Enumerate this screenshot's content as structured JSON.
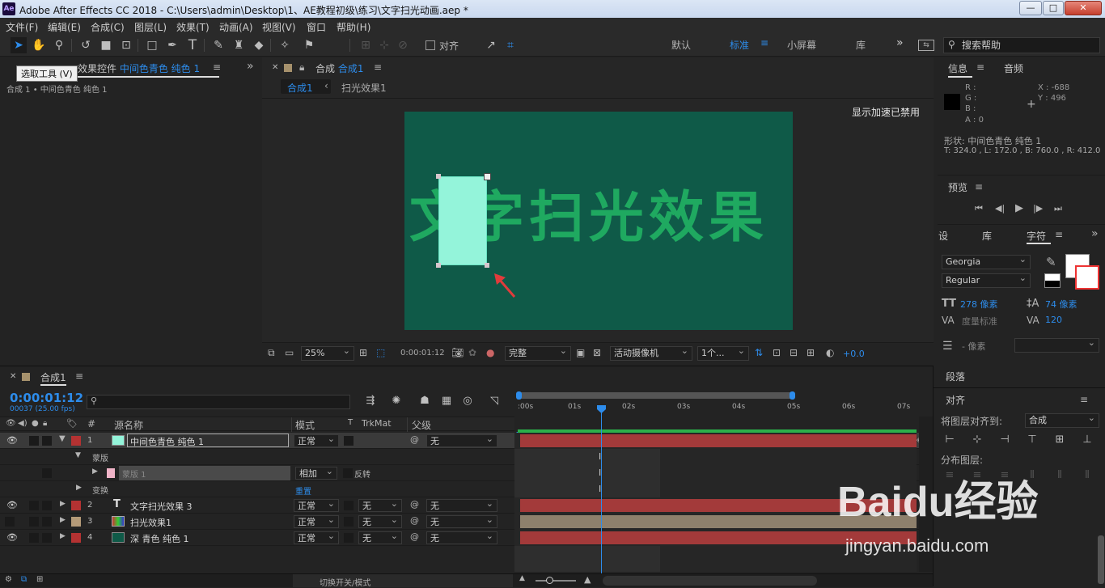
{
  "title": "Adobe After Effects CC 2018 - C:\\Users\\admin\\Desktop\\1、AE教程初级\\练习\\文字扫光动画.aep *",
  "window_buttons": {
    "minimize": "—",
    "maximize": "□",
    "close": "✕"
  },
  "menu": [
    "文件(F)",
    "编辑(E)",
    "合成(C)",
    "图层(L)",
    "效果(T)",
    "动画(A)",
    "视图(V)",
    "窗口",
    "帮助(H)"
  ],
  "toolbar": {
    "align_label": "对齐",
    "workspaces": [
      "默认",
      "标准",
      "小屏幕",
      "库"
    ],
    "search_placeholder": "搜索帮助"
  },
  "tooltip": "选取工具 (V)",
  "effects_panel": {
    "title_prefix": "效果控件",
    "layer_name": "中间色青色 纯色 1",
    "subtitle": "合成 1 • 中间色青色 纯色 1"
  },
  "comp_panel": {
    "title_prefix": "合成",
    "comp_name": "合成1",
    "breadcrumb": [
      "合成1",
      "扫光效果1"
    ],
    "gpu_notice": "显示加速已禁用",
    "canvas_text": "文字扫光效果",
    "bg_color": "#0f5a48",
    "text_color": "#1fa960",
    "rect_color": "#94f4da"
  },
  "viewer_bar": {
    "zoom": "25%",
    "timecode": "0:00:01:12",
    "resolution": "完整",
    "camera": "活动摄像机",
    "views": "1个...",
    "exposure": "+0.0"
  },
  "info_panel": {
    "tabs": [
      "信息",
      "音频"
    ],
    "r": "R :",
    "g": "G :",
    "b": "B :",
    "a": "A : 0",
    "x": "X : -688",
    "y": "Y : 496",
    "shape": "形状: 中间色青色 纯色 1",
    "bounds": "T: 324.0 , L: 172.0 , B: 760.0 , R: 412.0"
  },
  "preview_panel": {
    "title": "预览"
  },
  "char_panel": {
    "tabs": [
      "设",
      "库",
      "字符"
    ],
    "font": "Georgia",
    "style": "Regular",
    "size": "278 像素",
    "leading": "74 像素",
    "kerning": "度量标准",
    "tracking": "120",
    "stroke_unit": "- 像素"
  },
  "para_panel": {
    "title": "段落"
  },
  "align_panel": {
    "title": "对齐",
    "align_to_label": "将图层对齐到:",
    "align_to_value": "合成",
    "distribute_label": "分布图层:"
  },
  "timeline": {
    "tab": "合成1",
    "timecode": "0:00:01:12",
    "fps": "00037 (25.00 fps)",
    "columns": {
      "num": "#",
      "name": "源名称",
      "mode": "模式",
      "t": "T",
      "trkmat": "TrkMat",
      "parent": "父级"
    },
    "ruler": [
      ":00s",
      "01s",
      "02s",
      "03s",
      "04s",
      "05s",
      "06s",
      "07s"
    ],
    "layers": [
      {
        "num": "1",
        "name": "中间色青色 纯色 1",
        "mode": "正常",
        "trk": "",
        "parent": "无",
        "label_color": "#b43232",
        "swatch": "#94f4da"
      },
      {
        "num": "2",
        "name": "文字扫光效果 3",
        "mode": "正常",
        "trk": "无",
        "parent": "无",
        "label_color": "#b43232",
        "swatch": "T"
      },
      {
        "num": "3",
        "name": "扫光效果1",
        "mode": "正常",
        "trk": "无",
        "parent": "无",
        "label_color": "#b49a78",
        "swatch": "comp"
      },
      {
        "num": "4",
        "name": "深 青色 纯色 1",
        "mode": "正常",
        "trk": "无",
        "parent": "无",
        "label_color": "#b43232",
        "swatch": "#0f5a48"
      }
    ],
    "mask_group": "蒙版",
    "mask": {
      "name": "蒙版 1",
      "mode": "相加",
      "invert": "反转"
    },
    "transform": "变换",
    "reset": "重置",
    "footer": "切换开关/模式"
  },
  "watermark": {
    "brand": "Baidu经验",
    "url": "jingyan.baidu.com"
  }
}
